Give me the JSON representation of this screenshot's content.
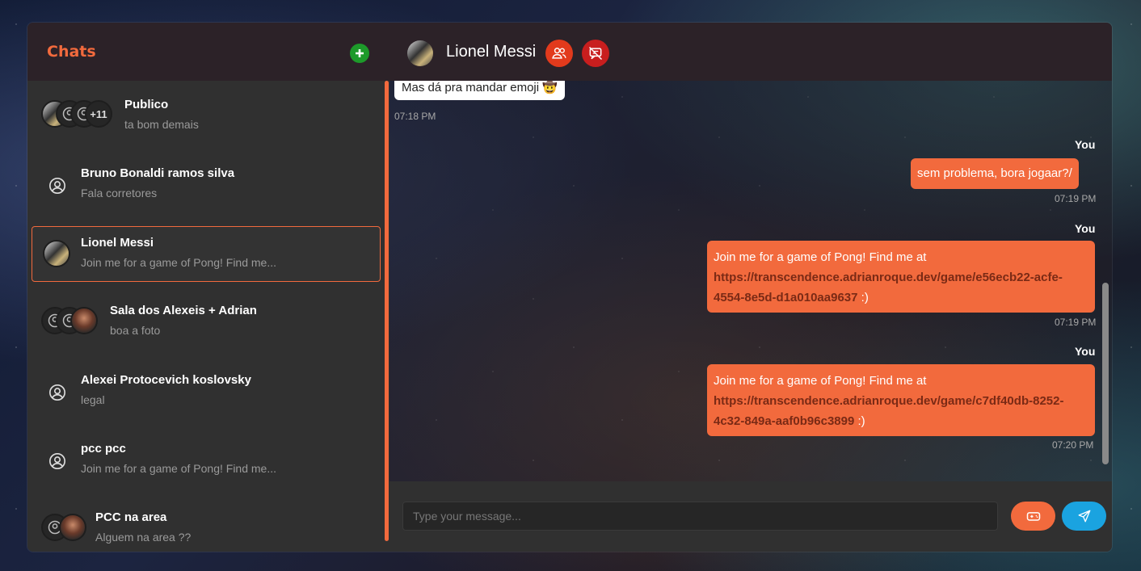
{
  "sidebar": {
    "title": "Chats",
    "add_icon": "plus-icon",
    "chats": [
      {
        "name": "Publico",
        "preview": "ta bom demais",
        "extra_count": "+11"
      },
      {
        "name": "Bruno Bonaldi ramos silva",
        "preview": "Fala corretores"
      },
      {
        "name": "Lionel Messi",
        "preview": "Join me for a game of Pong! Find me..."
      },
      {
        "name": "Sala dos Alexeis + Adrian",
        "preview": "boa a foto"
      },
      {
        "name": "Alexei Protocevich koslovsky",
        "preview": "legal"
      },
      {
        "name": "pcc pcc",
        "preview": "Join me for a game of Pong! Find me..."
      },
      {
        "name": "PCC na area",
        "preview": "Alguem na area ??"
      }
    ]
  },
  "header": {
    "name": "Lionel Messi",
    "members_icon": "users-icon",
    "block_icon": "message-off-icon"
  },
  "messages": [
    {
      "text": "Mas dá pra mandar emoji 🤠",
      "time": "07:18 PM"
    },
    {
      "author": "You",
      "text": "sem problema, bora jogaar?/",
      "time": "07:19 PM"
    },
    {
      "author": "You",
      "text": "Join me for a game of Pong! Find me at ",
      "link": "https://transcendence.adrianroque.dev/game/e56ecb22-acfe-4554-8e5d-d1a010aa9637",
      "suffix": " :)",
      "time": "07:19 PM"
    },
    {
      "author": "You",
      "text": "Join me for a game of Pong! Find me at ",
      "link": "https://transcendence.adrianroque.dev/game/c7df40db-8252-4c32-849a-aaf0b96c3899",
      "suffix": " :)",
      "time": "07:20 PM"
    }
  ],
  "composer": {
    "placeholder": "Type your message...",
    "game_icon": "gamepad-icon",
    "send_icon": "send-icon"
  },
  "colors": {
    "accent": "#f26a3d",
    "add": "#1d9a2a",
    "send": "#1aa3e0",
    "danger": "#e23a1c"
  }
}
